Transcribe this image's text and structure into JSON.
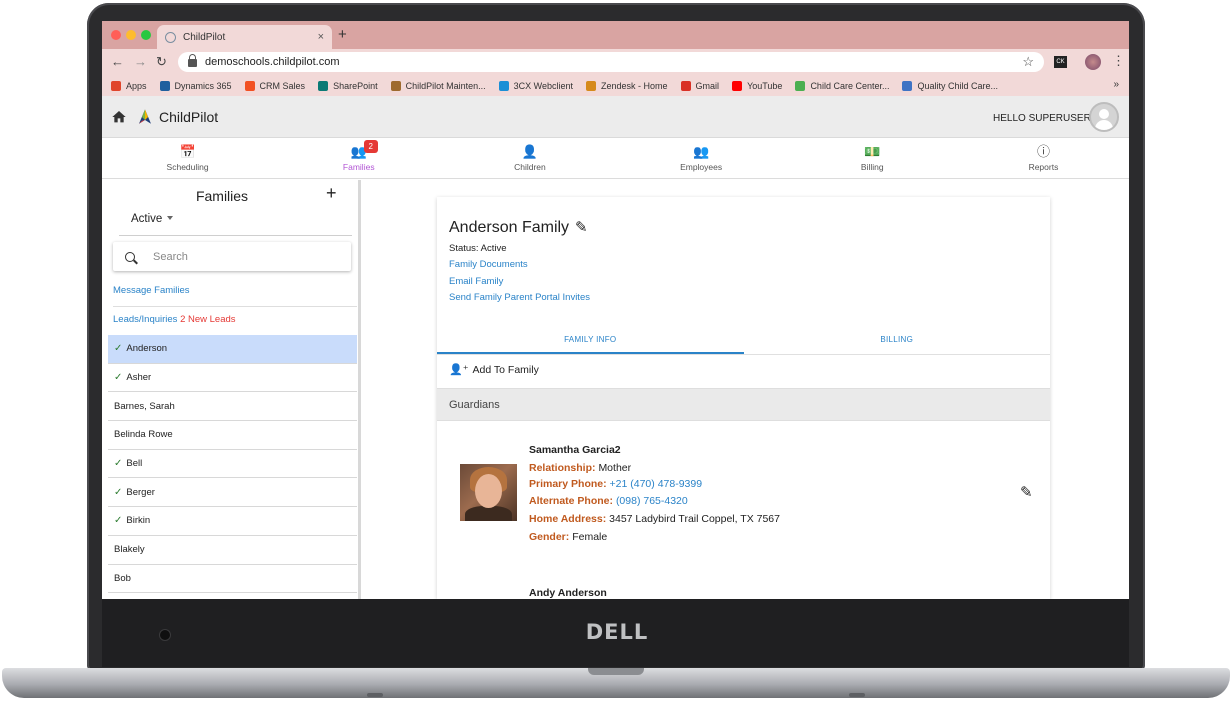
{
  "browser": {
    "tab_title": "ChildPilot",
    "tab_close": "×",
    "new_tab": "+",
    "url": "demoschools.childpilot.com",
    "ext_label": "CK",
    "more": "»",
    "bookmarks": [
      {
        "label": "Apps",
        "color": "#e0452b"
      },
      {
        "label": "Dynamics 365",
        "color": "#1f5f9e"
      },
      {
        "label": "CRM Sales",
        "color": "#f25022"
      },
      {
        "label": "SharePoint",
        "color": "#0b7a75"
      },
      {
        "label": "ChildPilot Mainten...",
        "color": "#9e6a2e"
      },
      {
        "label": "3CX Webclient",
        "color": "#1b8fd6"
      },
      {
        "label": "Zendesk - Home",
        "color": "#d68a1b"
      },
      {
        "label": "Gmail",
        "color": "#d93025"
      },
      {
        "label": "YouTube",
        "color": "#ff0000"
      },
      {
        "label": "Child Care Center...",
        "color": "#4caf50"
      },
      {
        "label": "Quality Child Care...",
        "color": "#3f73c4"
      }
    ]
  },
  "header": {
    "app_name": "ChildPilot",
    "greeting": "HELLO SUPERUSER"
  },
  "nav": {
    "tabs": [
      {
        "label": "Scheduling",
        "icon": "calendar-icon",
        "glyph": "📅"
      },
      {
        "label": "Families",
        "icon": "people-icon",
        "glyph": "👥",
        "badge": "2",
        "active": true
      },
      {
        "label": "Children",
        "icon": "person-icon",
        "glyph": "👤"
      },
      {
        "label": "Employees",
        "icon": "employees-icon",
        "glyph": "👥"
      },
      {
        "label": "Billing",
        "icon": "money-icon",
        "glyph": "💵"
      },
      {
        "label": "Reports",
        "icon": "info-icon",
        "glyph": "ⓘ"
      }
    ]
  },
  "sidebar": {
    "title": "Families",
    "add": "+",
    "status_value": "Active",
    "search_placeholder": "Search",
    "message_link": "Message Families",
    "leads_link": "Leads/Inquiries",
    "leads_count": "2 New Leads",
    "families": [
      {
        "name": "Anderson",
        "checked": true,
        "selected": true
      },
      {
        "name": "Asher",
        "checked": true
      },
      {
        "name": "Barnes, Sarah",
        "checked": false
      },
      {
        "name": "Belinda Rowe",
        "checked": false
      },
      {
        "name": "Bell",
        "checked": true
      },
      {
        "name": "Berger",
        "checked": true
      },
      {
        "name": "Birkin",
        "checked": true
      },
      {
        "name": "Blakely",
        "checked": false
      },
      {
        "name": "Bob",
        "checked": false
      }
    ]
  },
  "family": {
    "name": "Anderson Family",
    "status": "Status: Active",
    "links": [
      "Family Documents",
      "Email Family",
      "Send Family Parent Portal Invites"
    ],
    "tabs": [
      "FAMILY INFO",
      "BILLING"
    ],
    "add_to_family": "Add To Family",
    "guardians_heading": "Guardians",
    "guardians": [
      {
        "name": "Samantha Garcia2",
        "relationship_label": "Relationship:",
        "relationship": "Mother",
        "primary_label": "Primary Phone:",
        "primary": "+21 (470) 478-9399",
        "alternate_label": "Alternate Phone:",
        "alternate": "(098) 765-4320",
        "address_label": "Home Address:",
        "address": "3457 Ladybird Trail Coppel, TX 7567",
        "gender_label": "Gender:",
        "gender": "Female"
      },
      {
        "name": "Andy Anderson"
      }
    ]
  },
  "laptop": {
    "brand": "DELL"
  },
  "colors": {
    "chrome_tab_strip": "#d9a4a2",
    "chrome_toolbar": "#f2d9d8",
    "active_nav": "#b255d5",
    "link": "#2a83c8",
    "label_orange": "#c05a1f",
    "selected_row": "#c9dcfb",
    "badge": "#e53935"
  }
}
